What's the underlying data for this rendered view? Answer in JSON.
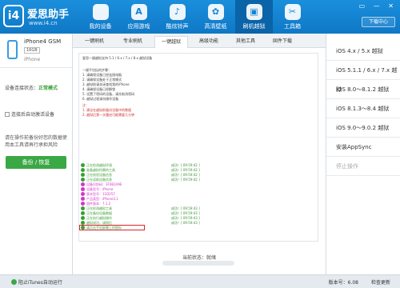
{
  "app": {
    "brand": "爱思助手",
    "url": "www.i4.cn",
    "logo": "i4"
  },
  "nav": [
    {
      "label": "我的设备",
      "icon": "apple-icon",
      "glyph": ""
    },
    {
      "label": "应用游戏",
      "icon": "app-store-icon",
      "glyph": "A"
    },
    {
      "label": "酷炫铃声",
      "icon": "bell-icon",
      "glyph": "♪"
    },
    {
      "label": "高清壁纸",
      "icon": "flower-icon",
      "glyph": "✿"
    },
    {
      "label": "刷机越狱",
      "icon": "box-icon",
      "glyph": "▣"
    },
    {
      "label": "工具箱",
      "icon": "tools-icon",
      "glyph": "✂"
    }
  ],
  "header": {
    "download_center": "下载中心"
  },
  "device": {
    "name": "iPhone4 GSM",
    "capacity": "16GB",
    "type": "iPhone",
    "conn_prefix": "设备连接状态：",
    "conn_status": "正常模式",
    "auto_activate": "连接后自动激活设备",
    "note": "请在操作前备份好您的数据使用本工具请再行承担风险",
    "backup_button": "备份 / 恢复"
  },
  "tabs": [
    "一键刷机",
    "专业刷机",
    "一键越狱",
    "高级功能",
    "其他工具",
    "固件下载"
  ],
  "log": {
    "header": "爱思一键越狱支持 5.1 / 6.x / 7.x / 8.x 越狱设备",
    "tips": [
      "一键不包括的步骤：",
      "1. 请确保设备已经连接电脑",
      "2. 请确保设备处于正常模式",
      "3. 越狱前请关闭查找我的iPhone",
      "4. 请确保设备已经解锁",
      "5. 设置了密码的设备，请先取消密码",
      "6. 越狱过程请勿操作设备"
    ],
    "warn": [
      "注：",
      "1. 建议在越狱前备份设备中的数据",
      "2. 越狱后第一次重启可能需要几分钟"
    ],
    "steps": [
      {
        "msg": "正在检测越狱环境",
        "res": "成功！[ 09:59:42 ]",
        "color": "#3a9e35"
      },
      {
        "msg": "准备越狱所需的工具",
        "res": "成功！[ 09:59:42 ]",
        "color": "#3a9e35"
      },
      {
        "msg": "正在校验设备信息",
        "res": "成功！[ 09:59:42 ]",
        "color": "#3a9e35"
      },
      {
        "msg": "正在读取设备信息",
        "res": "成功！[ 09:59:42 ]",
        "color": "#3a9e35"
      },
      {
        "msg": "设备识别码：3F0B1A9E",
        "res": "",
        "color": "#d038c8"
      },
      {
        "msg": "设备型号：iPhone",
        "res": "",
        "color": "#d038c8"
      },
      {
        "msg": "版本型号：11D257",
        "res": "",
        "color": "#d038c8"
      },
      {
        "msg": "产品类型：iPhone3,1",
        "res": "",
        "color": "#d038c8"
      },
      {
        "msg": "固件版本：7.1.2",
        "res": "",
        "color": "#d038c8"
      },
      {
        "msg": "正在检测越狱工具",
        "res": "成功！[ 09:59:43 ]",
        "color": "#3a9e35"
      },
      {
        "msg": "正在备份设备数据",
        "res": "成功！[ 09:59:43 ]",
        "color": "#3a9e35"
      },
      {
        "msg": "正在执行越狱操作",
        "res": "成功！[ 09:59:43 ]",
        "color": "#3a9e35"
      },
      {
        "msg": "越狱成功，请稍后",
        "res": "成功！[ 09:59:43 ]",
        "color": "#3a9e35"
      },
      {
        "msg": "请点击手机屏幕上的图标",
        "res": "",
        "color": "#3a9e35"
      }
    ],
    "status": "当前状态：就绪"
  },
  "right": [
    {
      "label": "iOS 4.x / 5.x 越狱",
      "disabled": false
    },
    {
      "label": "iOS 5.1.1 / 6.x / 7.x 越狱",
      "disabled": false
    },
    {
      "label": "iOS 8.0～8.1.2 越狱",
      "disabled": false
    },
    {
      "label": "iOS 8.1.3～8.4 越狱",
      "disabled": false
    },
    {
      "label": "iOS 9.0～9.0.2 越狱",
      "disabled": false
    },
    {
      "label": "安装AppSync",
      "disabled": false
    },
    {
      "label": "停止操作",
      "disabled": true
    }
  ],
  "footer": {
    "itunes": "阻止iTunes自动运行",
    "version": "版本号：6.08",
    "update": "检查更新"
  }
}
